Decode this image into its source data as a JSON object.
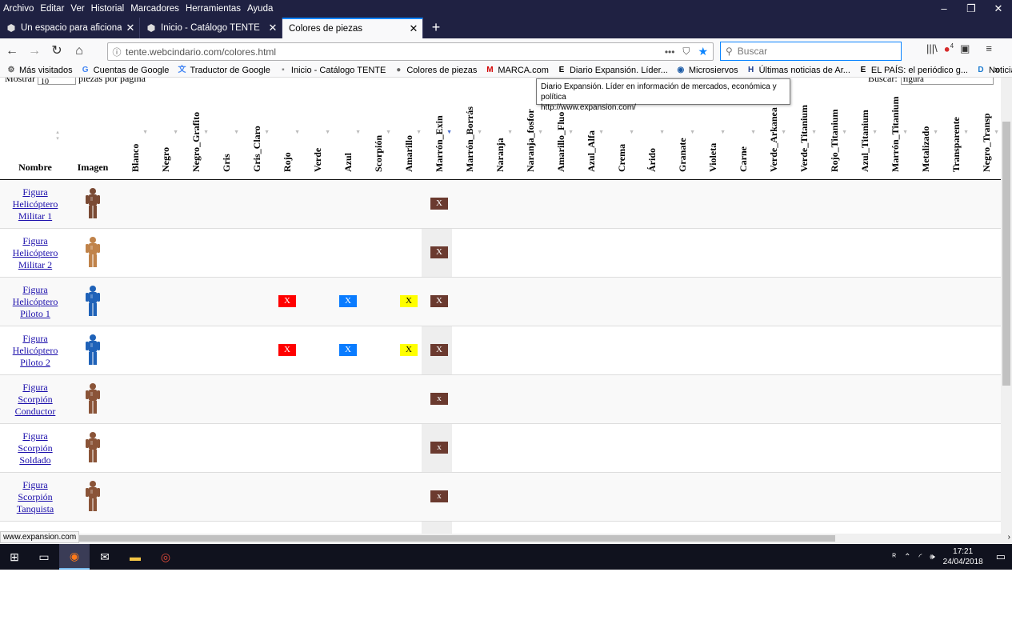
{
  "menu": [
    "Archivo",
    "Editar",
    "Ver",
    "Historial",
    "Marcadores",
    "Herramientas",
    "Ayuda"
  ],
  "window_controls": [
    "–",
    "❐",
    "✕"
  ],
  "tabs": [
    {
      "label": "Un espacio para aficionados a",
      "close": "✕",
      "active": false
    },
    {
      "label": "Inicio - Catálogo TENTE",
      "close": "✕",
      "active": false
    },
    {
      "label": "Colores de piezas",
      "close": "✕",
      "active": true
    }
  ],
  "new_tab": "+",
  "nav": {
    "back": "←",
    "forward": "→",
    "reload": "↻",
    "home": "⌂"
  },
  "url": "tente.webcindario.com/colores.html",
  "url_actions": [
    "•••",
    "⛉",
    "★"
  ],
  "search_placeholder": "Buscar",
  "right_nav": [
    "|||\\",
    "●",
    "▣",
    "≡"
  ],
  "addon_badge": "4",
  "bookmarks": [
    {
      "label": "Más visitados",
      "icon": "⚙",
      "color": "#555"
    },
    {
      "label": "Cuentas de Google",
      "icon": "G",
      "color": "#4285f4"
    },
    {
      "label": "Traductor de Google",
      "icon": "文",
      "color": "#4285f4"
    },
    {
      "label": "Inicio - Catálogo TENTE",
      "icon": "▪",
      "color": "#888"
    },
    {
      "label": "Colores de piezas",
      "icon": "●",
      "color": "#666"
    },
    {
      "label": "MARCA.com",
      "icon": "M",
      "color": "#d20000"
    },
    {
      "label": "Diario Expansión. Líder...",
      "icon": "E",
      "color": "#000"
    },
    {
      "label": "Microsiervos",
      "icon": "◉",
      "color": "#1a5aa6"
    },
    {
      "label": "Últimas noticias de Ar...",
      "icon": "H",
      "color": "#1a3a8a"
    },
    {
      "label": "EL PAÍS: el periódico g...",
      "icon": "E",
      "color": "#000"
    },
    {
      "label": "Noticias de última hor...",
      "icon": "D",
      "color": "#1a7ad0"
    }
  ],
  "bookmarks_more": "»",
  "tooltip": {
    "title": "Diario Expansión. Líder en información de mercados, económica y política",
    "url": "http://www.expansion.com/"
  },
  "page": {
    "show_prefix": "Mostrar",
    "show_value": "10",
    "show_suffix": "piezas por página",
    "search_label": "Buscar:",
    "search_value": "figura",
    "col_nombre": "Nombre",
    "col_imagen": "Imagen",
    "colors": [
      "Blanco",
      "Negro",
      "Negro_Grafito",
      "Gris",
      "Gris_Claro",
      "Rojo",
      "Verde",
      "Azul",
      "Scorpión",
      "Amarillo",
      "Marrón_Exin",
      "Marrón_Borrás",
      "Naranja",
      "Naranja_fosfor",
      "Amarillo_Fluo",
      "Azul_Alfa",
      "Crema",
      "Árido",
      "Granate",
      "Violeta",
      "Carne",
      "Verde_Arkanea",
      "Verde_Titanium",
      "Rojo_Titanium",
      "Azul_Titanium",
      "Marrón_Titanium",
      "Metalizado",
      "Transparente",
      "Negro_Transp"
    ],
    "sorted_column": "Marrón_Exin",
    "rows": [
      {
        "name": [
          "Figura",
          "Helicóptero",
          "Militar 1"
        ],
        "figure": "brown",
        "marks": [
          {
            "col": "Marrón_Exin",
            "text": "X"
          }
        ]
      },
      {
        "name": [
          "Figura",
          "Helicóptero",
          "Militar 2"
        ],
        "figure": "tan",
        "marks": [
          {
            "col": "Marrón_Exin",
            "text": "X"
          }
        ]
      },
      {
        "name": [
          "Figura",
          "Helicóptero",
          "Piloto 1"
        ],
        "figure": "blue",
        "marks": [
          {
            "col": "Rojo",
            "text": "X"
          },
          {
            "col": "Azul",
            "text": "X"
          },
          {
            "col": "Amarillo",
            "text": "X"
          },
          {
            "col": "Marrón_Exin",
            "text": "X"
          }
        ]
      },
      {
        "name": [
          "Figura",
          "Helicóptero",
          "Piloto 2"
        ],
        "figure": "blue",
        "marks": [
          {
            "col": "Rojo",
            "text": "X"
          },
          {
            "col": "Azul",
            "text": "X"
          },
          {
            "col": "Amarillo",
            "text": "X"
          },
          {
            "col": "Marrón_Exin",
            "text": "X"
          }
        ]
      },
      {
        "name": [
          "Figura",
          "Scorpión",
          "Conductor"
        ],
        "figure": "rust",
        "marks": [
          {
            "col": "Marrón_Exin",
            "text": "x"
          }
        ]
      },
      {
        "name": [
          "Figura",
          "Scorpión",
          "Soldado"
        ],
        "figure": "rust",
        "marks": [
          {
            "col": "Marrón_Exin",
            "text": "x"
          }
        ]
      },
      {
        "name": [
          "Figura",
          "Scorpión",
          "Tanquista"
        ],
        "figure": "rust",
        "marks": [
          {
            "col": "Marrón_Exin",
            "text": "x"
          }
        ]
      }
    ]
  },
  "mark_colors": {
    "Rojo": "#ff0000",
    "Azul": "#0a7cff",
    "Amarillo": "#ffff00",
    "Marrón_Exin": "#6b3a2f"
  },
  "mark_text_colors": {
    "Rojo": "#ffffff",
    "Azul": "#ffffff",
    "Amarillo": "#000000",
    "Marrón_Exin": "#ffffff"
  },
  "figure_colors": {
    "brown": "#7a4a34",
    "tan": "#c0834a",
    "blue": "#1f62b8",
    "rust": "#8a5438"
  },
  "status_url": "www.expansion.com",
  "taskbar": {
    "items": [
      "start-icon",
      "task-view-icon",
      "firefox-icon",
      "mail-icon",
      "folder-icon",
      "chrome-icon"
    ],
    "time": "17:21",
    "date": "24/04/2018"
  }
}
